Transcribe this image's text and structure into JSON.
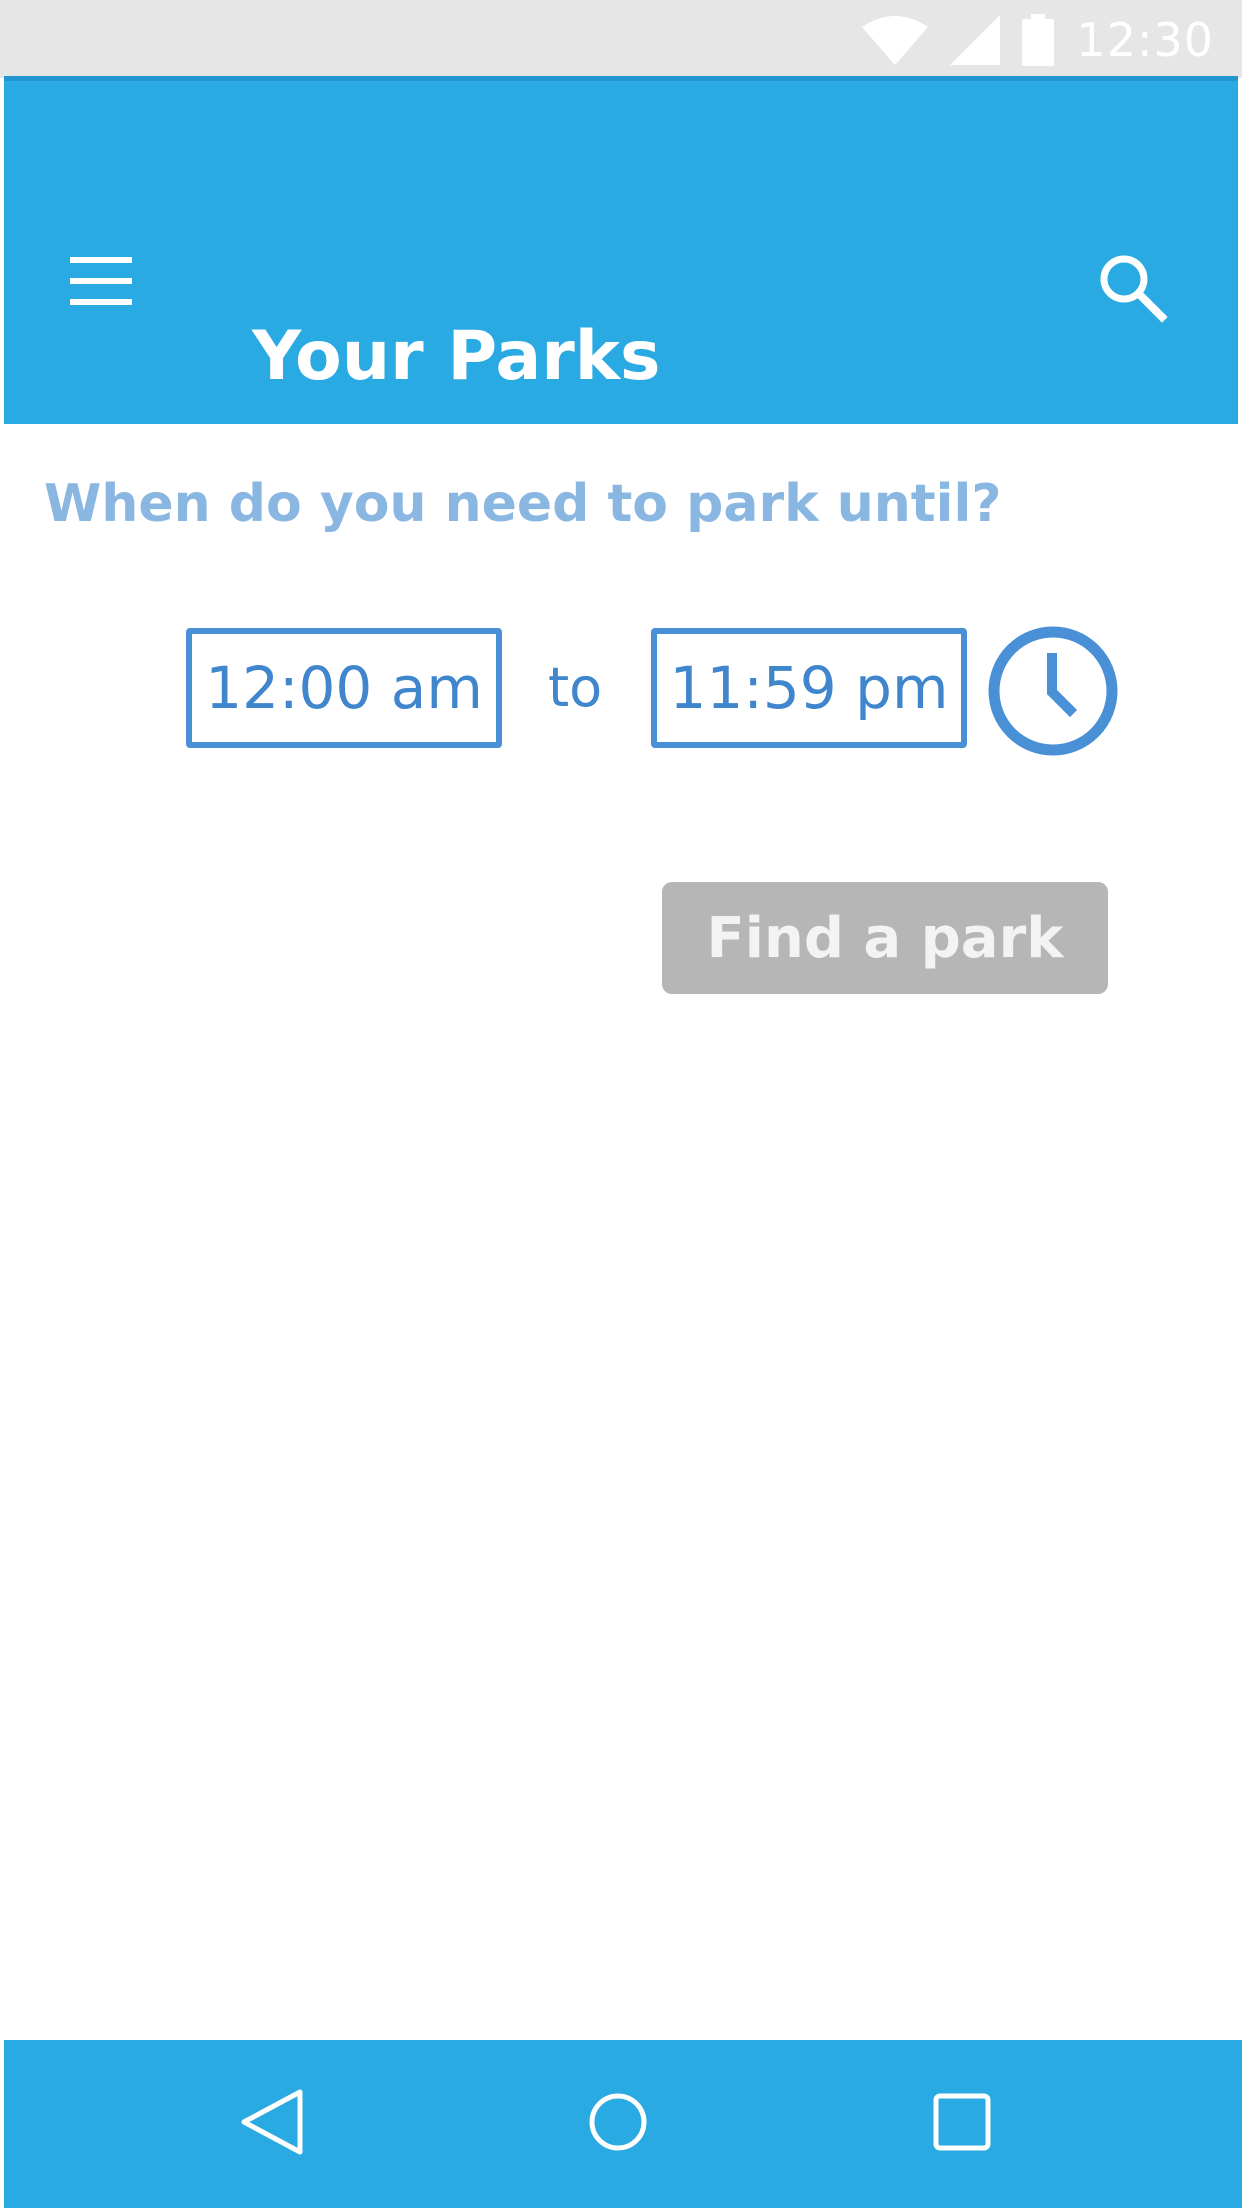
{
  "status_bar": {
    "time": "12:30",
    "icons": [
      "wifi-icon",
      "signal-icon",
      "battery-icon"
    ]
  },
  "app_bar": {
    "title": "Your Parks",
    "menu_icon": "menu-icon",
    "search_icon": "search-icon"
  },
  "main": {
    "question": "When do you need to park until?",
    "time_from": "12:00 am",
    "to_label": "to",
    "time_to": "11:59 pm",
    "clock_icon": "clock-icon",
    "find_button": "Find a park"
  },
  "nav_bar": {
    "icons": [
      "back-icon",
      "home-icon",
      "recents-icon"
    ]
  },
  "colors": {
    "primary": "#2aaae2",
    "accent": "#4a90d6",
    "question_text": "#89b7e2",
    "disabled_button": "#b6b6b6"
  }
}
